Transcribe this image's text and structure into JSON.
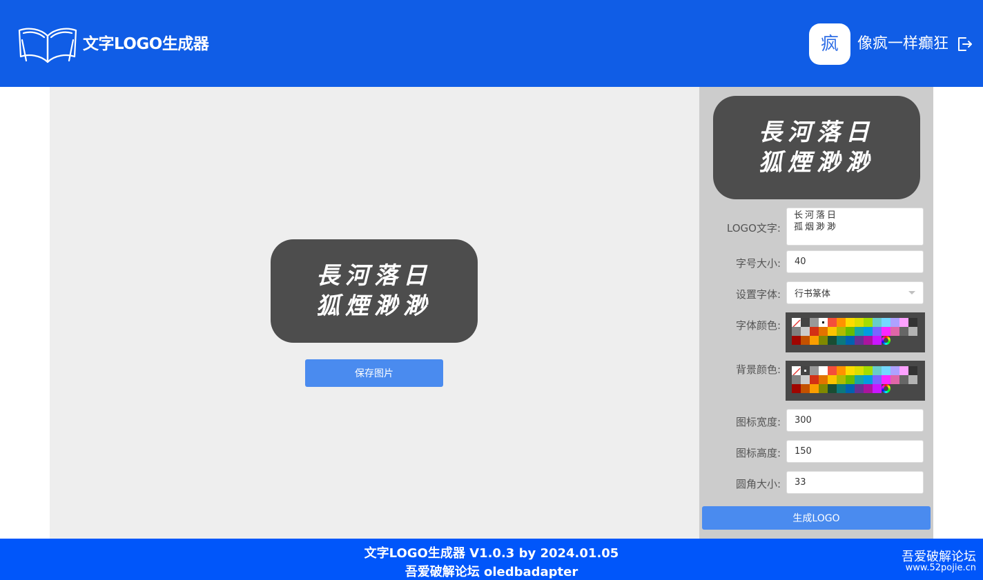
{
  "header": {
    "app_title": "文字LOGO生成器",
    "avatar_char": "疯",
    "user_name": "像疯一样癫狂"
  },
  "preview": {
    "logo_line1": "長河落日",
    "logo_line2": "狐煙渺渺",
    "save_label": "保存图片"
  },
  "panel": {
    "preview_line1": "長河落日",
    "preview_line2": "狐煙渺渺",
    "logo_text_label": "LOGO文字:",
    "logo_text_value": "长河落日\n孤烟渺渺",
    "font_size_label": "字号大小:",
    "font_size_value": "40",
    "font_label": "设置字体:",
    "font_value": "行书篆体",
    "font_color_label": "字体颜色:",
    "bg_color_label": "背景颜色:",
    "width_label": "图标宽度:",
    "width_value": "300",
    "height_label": "图标高度:",
    "height_value": "150",
    "radius_label": "圆角大小:",
    "radius_value": "33",
    "generate_label": "生成LOGO"
  },
  "colors": {
    "header_bg": "#105de6",
    "footer_bg": "#0056fa",
    "button": "#4a8bef",
    "logo_bg": "#4d4d4d",
    "logo_text": "#ffffff",
    "palette_rows": [
      [
        "none",
        "#444444",
        "#999999",
        "#ffffff",
        "#f44e3b",
        "#fe9200",
        "#fcdc00",
        "#dbdf00",
        "#a4dd00",
        "#68ccca",
        "#73d8ff",
        "#aea1ff",
        "#fda1ff",
        "#333333"
      ],
      [
        "#808080",
        "#cccccc",
        "#d33115",
        "#e27300",
        "#fcc400",
        "#b0bc00",
        "#68bc00",
        "#16a5a5",
        "#009ce0",
        "#7b64ff",
        "#fa28ff",
        "#e066a8",
        "#666666",
        "#b3b3b3"
      ],
      [
        "#9f0500",
        "#c45100",
        "#fb9e00",
        "#808900",
        "#194d33",
        "#0c797d",
        "#0062b1",
        "#653294",
        "#ab149e",
        "#c916ff",
        "#picker"
      ]
    ],
    "font_color_selected": 3,
    "bg_color_selected": 1
  },
  "footer": {
    "line1": "文字LOGO生成器 V1.0.3 by 2024.01.05",
    "line2": "吾爱破解论坛 oledbadapter",
    "watermark_cn": "吾爱破解论坛",
    "watermark_url": "www.52pojie.cn"
  }
}
